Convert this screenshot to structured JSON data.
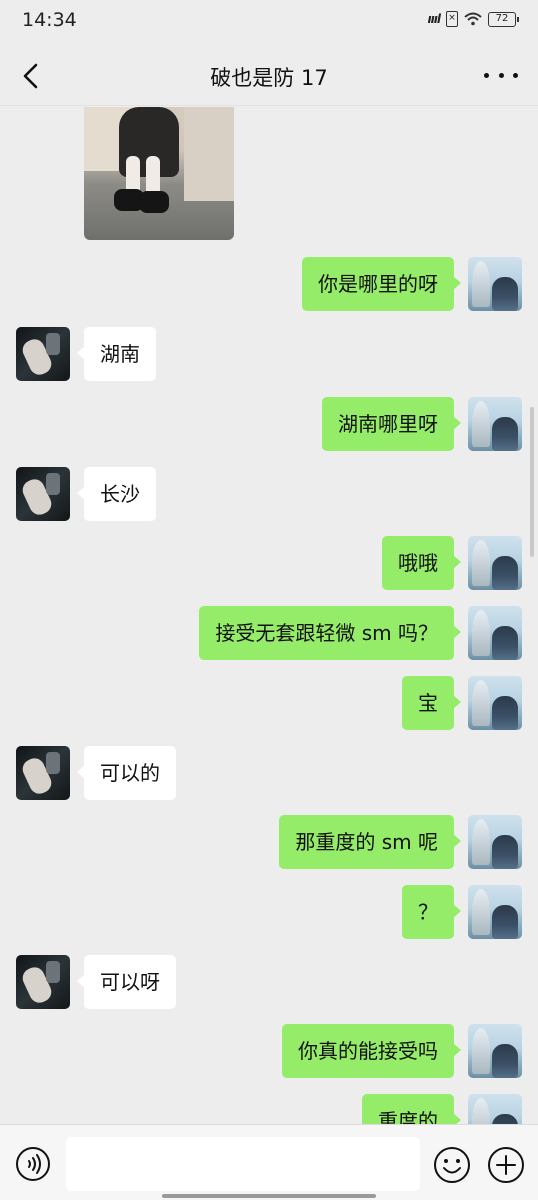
{
  "status": {
    "time": "14:34",
    "signal": "ᴴᴰ",
    "sim": "×",
    "wifi_icon": "wifi-icon",
    "battery": "72"
  },
  "header": {
    "title": "破也是防  17",
    "back_icon": "back-chevron-icon",
    "more_icon": "more-dots-icon"
  },
  "messages": [
    {
      "side": "right",
      "text": "你是哪里的呀"
    },
    {
      "side": "left",
      "text": "湖南"
    },
    {
      "side": "right",
      "text": "湖南哪里呀"
    },
    {
      "side": "left",
      "text": "长沙"
    },
    {
      "side": "right",
      "text": "哦哦"
    },
    {
      "side": "right",
      "text": "接受无套跟轻微 sm 吗？"
    },
    {
      "side": "right",
      "text": "宝"
    },
    {
      "side": "left",
      "text": "可以的"
    },
    {
      "side": "right",
      "text": "那重度的 sm 呢"
    },
    {
      "side": "right",
      "text": "？"
    },
    {
      "side": "left",
      "text": "可以呀"
    },
    {
      "side": "right",
      "text": "你真的能接受吗"
    },
    {
      "side": "right",
      "text": "重度的"
    }
  ],
  "input": {
    "placeholder": "",
    "voice_icon": "voice-icon",
    "emoji_icon": "emoji-icon",
    "plus_icon": "plus-icon"
  }
}
